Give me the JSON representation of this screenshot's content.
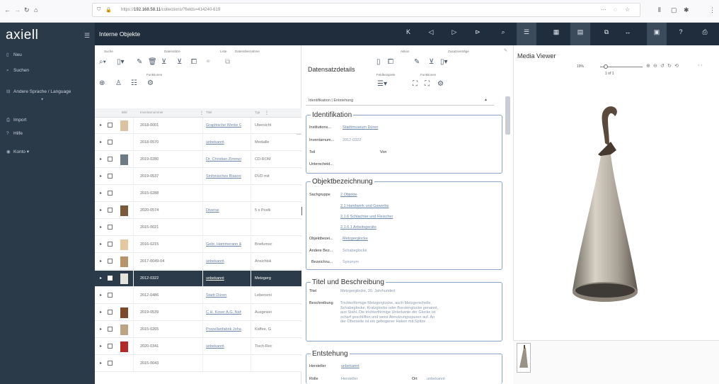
{
  "browser": {
    "url_prefix": "https://",
    "url_host": "192.168.58.11",
    "url_path": "/collections/?fields=414240-619"
  },
  "sidebar": {
    "logo": "axiell",
    "items": [
      {
        "label": "Neu",
        "icon": "new-document-icon"
      },
      {
        "label": "Suchen",
        "icon": "search-icon"
      },
      {
        "label": "Andere Sprache / Language",
        "icon": "language-icon"
      },
      {
        "label": "Import",
        "icon": "import-icon"
      },
      {
        "label": "Hilfe",
        "icon": "help-icon"
      },
      {
        "label": "Konto",
        "icon": "account-icon"
      }
    ]
  },
  "header": {
    "title": "Interne Objekte"
  },
  "toolbar_left": {
    "suche": "Suche",
    "datensatze": "Datensätze",
    "liste": "Liste",
    "datenubernahme": "Datenübernahme",
    "funktionen": "Funktionen"
  },
  "table": {
    "columns": [
      "Bild",
      "Inventarnummer",
      "Titel",
      "Typ"
    ],
    "rows": [
      {
        "num": "2018-0001",
        "title": "Graphische Werke G. Kü",
        "type": "Übersicht",
        "thumb": "#d9c3a1",
        "selected": false
      },
      {
        "num": "2018-0570",
        "title": "unbekannt",
        "type": "Medaille",
        "thumb": "",
        "selected": false
      },
      {
        "num": "2019-0280",
        "title": "Dr. Christian Zimmer, Fo",
        "type": "CD-ROM",
        "thumb": "#6d7c84",
        "selected": false
      },
      {
        "num": "2019-0537",
        "title": "Sinfonisches Blasorchest",
        "type": "DVD mit",
        "thumb": "",
        "selected": false
      },
      {
        "num": "2015-0288",
        "title": "",
        "type": "",
        "thumb": "",
        "selected": false
      },
      {
        "num": "2020-0574",
        "title": "Diverse",
        "type": "5 x Postk",
        "thumb": "#7a5a3a",
        "selected": false
      },
      {
        "num": "2015-0021",
        "title": "",
        "type": "",
        "thumb": "",
        "selected": false
      },
      {
        "num": "2016-0215",
        "title": "Gebr. Hammerann & Cie.",
        "type": "Briefumsc",
        "thumb": "#e4c9a0",
        "selected": false
      },
      {
        "num": "2017-0049-04",
        "title": "unbekannt",
        "type": "Ansichtsk",
        "thumb": "#b8946a",
        "selected": false
      },
      {
        "num": "2012-0322",
        "title": "unbekannt",
        "type": "Metzgerg",
        "thumb": "#e6e3de",
        "selected": true
      },
      {
        "num": "2012-0486",
        "title": "Stadt Düren",
        "type": "Lebensmi",
        "thumb": "",
        "selected": false
      },
      {
        "num": "2019-0539",
        "title": "C.H. Koser A.G. Nahrung",
        "type": "Ausgewei",
        "thumb": "#7c4a2a",
        "selected": false
      },
      {
        "num": "2015-0265",
        "title": "Porzellanfabrik Johann W",
        "type": "Kaffee, G",
        "thumb": "#bca485",
        "selected": false
      },
      {
        "num": "2020-0341",
        "title": "unbekannt",
        "type": "Tisch-Rec",
        "thumb": "#b22a2a",
        "selected": false
      },
      {
        "num": "2015-0043",
        "title": "",
        "type": "",
        "thumb": "",
        "selected": false
      }
    ]
  },
  "details": {
    "heading": "Datensatzdetails",
    "action": "Aktion",
    "zusatz": "Zusatzeinträge",
    "feldbeispiele": "Feldbeispiele",
    "funktionen": "Funktionen",
    "tab_selector": "Identifikation | Entstehung",
    "identifikation": {
      "title": "Identifikation",
      "institution_label": "Institutions...",
      "institution_value": "Stadtmuseum Düren",
      "inventar_label": "Inventarnum...",
      "inventar_value": "2012-0322",
      "teil_label": "Teil",
      "von_label": "Von",
      "untersch_label": "Unterscheid..."
    },
    "objektbezeichnung": {
      "title": "Objektbezeichnung",
      "sachgruppe_label": "Sachgruppe",
      "sachgruppe_values": [
        "2 Objekte",
        "2.1 Handwerk und Gewerbe",
        "2.1.6 Schlachter und Fleischer",
        "2.1.6.1 Arbeitsgeräte"
      ],
      "objektbez_label": "Objektbezei...",
      "objektbez_value": "Metzgerglocke",
      "andere_label": "Andere Bez...",
      "andere_value": "Schabeglocke",
      "bezeichnu_label": "Bezeichnu...",
      "bezeichnu_value": "Synonym"
    },
    "titel": {
      "title": "Titel und Beschreibung",
      "titel_label": "Titel",
      "titel_value": "Metzgerglocke, 20. Jahrhundert",
      "beschreibung_label": "Beschreibung",
      "beschreibung_value": "Trichterförmige Metzgerglocke, auch Metzgerschelle, Schabeglocke, Kratzglocke oder Borstenglocke genannt, aus Stahl. Die trichterförmige Unterkante der Glocke ist scharf geschliffen und weist Abnutzungsspuren auf. An der Oberseite ist ein gebogener Haken mit Spitze"
    },
    "entstehung": {
      "title": "Entstehung",
      "hersteller_label": "Hersteller",
      "hersteller_value": "unbekannt",
      "rolle_label": "Rolle",
      "rolle_value": "Hersteller",
      "ort_label": "Ort",
      "ort_value": "unbekannt"
    }
  },
  "media": {
    "title": "Media Viewer",
    "zoom": "19%",
    "pages": "1 of 1"
  }
}
